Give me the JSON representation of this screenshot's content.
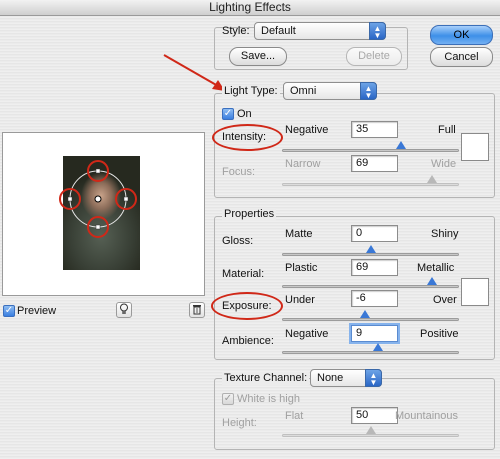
{
  "window": {
    "title": "Lighting Effects"
  },
  "style": {
    "label": "Style:",
    "value": "Default",
    "save": "Save...",
    "delete": "Delete"
  },
  "buttons": {
    "ok": "OK",
    "cancel": "Cancel"
  },
  "light": {
    "type_label": "Light Type:",
    "type_value": "Omni",
    "on_label": "On",
    "on_checked": true,
    "intensity": {
      "label": "Intensity:",
      "min_label": "Negative",
      "max_label": "Full",
      "value": "35",
      "position": 35,
      "range": [
        -100,
        100
      ]
    },
    "focus": {
      "label": "Focus:",
      "min_label": "Narrow",
      "max_label": "Wide",
      "value": "69",
      "position": 69,
      "range": [
        -100,
        100
      ],
      "enabled": false
    }
  },
  "properties": {
    "title": "Properties",
    "gloss": {
      "label": "Gloss:",
      "min_label": "Matte",
      "max_label": "Shiny",
      "value": "0",
      "position": 0,
      "range": [
        -100,
        100
      ]
    },
    "material": {
      "label": "Material:",
      "min_label": "Plastic",
      "max_label": "Metallic",
      "value": "69",
      "position": 69,
      "range": [
        -100,
        100
      ]
    },
    "exposure": {
      "label": "Exposure:",
      "min_label": "Under",
      "max_label": "Over",
      "value": "-6",
      "position": -6,
      "range": [
        -100,
        100
      ]
    },
    "ambience": {
      "label": "Ambience:",
      "min_label": "Negative",
      "max_label": "Positive",
      "value": "9",
      "position": 9,
      "range": [
        -100,
        100
      ]
    }
  },
  "texture": {
    "label": "Texture Channel:",
    "value": "None",
    "white_is_high": "White is high",
    "height": {
      "label": "Height:",
      "min_label": "Flat",
      "max_label": "Mountainous",
      "value": "50",
      "position": 50,
      "range": [
        0,
        100
      ],
      "enabled": false
    }
  },
  "preview": {
    "label": "Preview",
    "checked": true
  },
  "colors": {
    "annotation": "#d02818",
    "accent": "#3a78d6"
  },
  "icons": {
    "popup_arrow": "up-down-arrows-icon",
    "light_bulb": "light-bulb-icon",
    "trash": "trash-icon"
  }
}
